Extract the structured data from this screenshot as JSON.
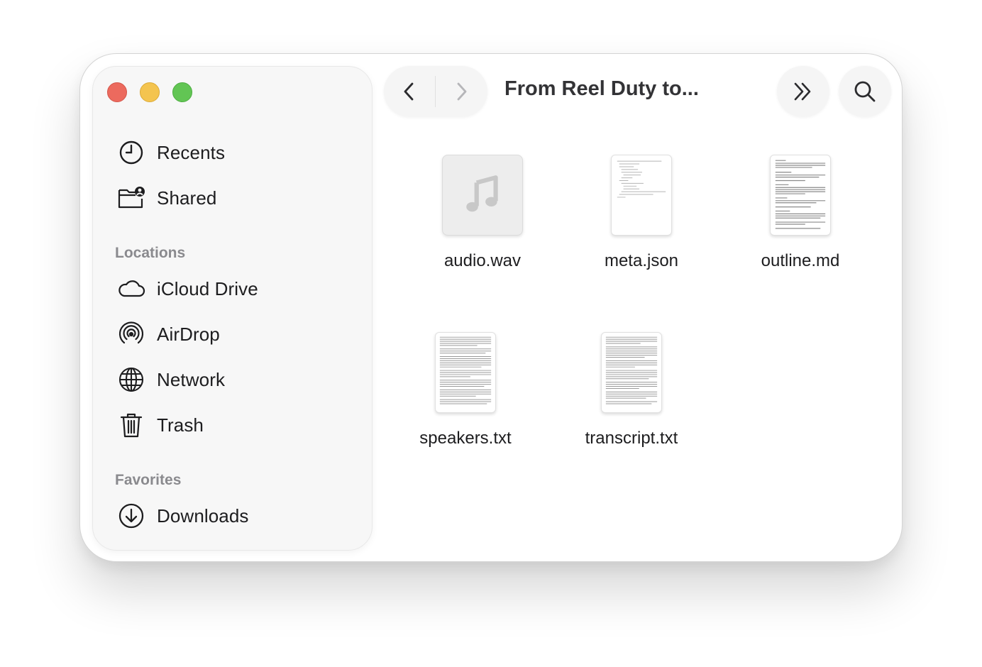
{
  "window": {
    "title": "From Reel Duty to..."
  },
  "sidebar": {
    "items": [
      {
        "label": "Recents",
        "icon": "clock-icon"
      },
      {
        "label": "Shared",
        "icon": "shared-folder-icon"
      }
    ],
    "locations_title": "Locations",
    "locations": [
      {
        "label": "iCloud Drive",
        "icon": "cloud-icon"
      },
      {
        "label": "AirDrop",
        "icon": "airdrop-icon"
      },
      {
        "label": "Network",
        "icon": "globe-icon"
      },
      {
        "label": "Trash",
        "icon": "trash-icon"
      }
    ],
    "favorites_title": "Favorites",
    "favorites": [
      {
        "label": "Downloads",
        "icon": "download-icon"
      }
    ]
  },
  "files": [
    {
      "name": "audio.wav",
      "type": "audio"
    },
    {
      "name": "meta.json",
      "type": "json"
    },
    {
      "name": "outline.md",
      "type": "markdown"
    },
    {
      "name": "speakers.txt",
      "type": "text"
    },
    {
      "name": "transcript.txt",
      "type": "text"
    }
  ],
  "colors": {
    "close": "#ec6a5e",
    "minimize": "#f4c44f",
    "zoom": "#62c554"
  }
}
